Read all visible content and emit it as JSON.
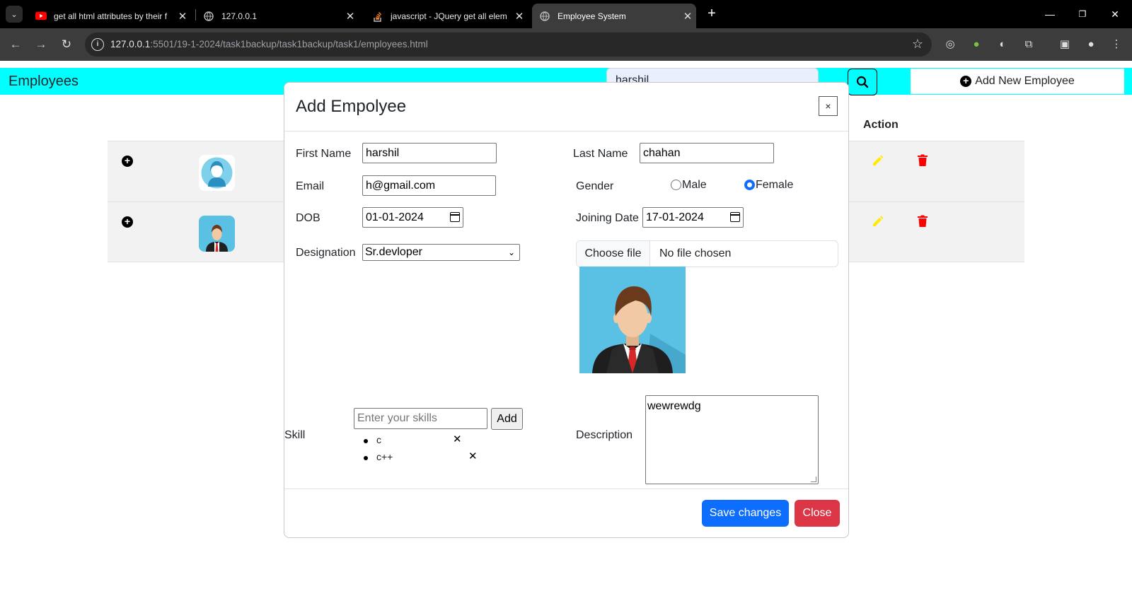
{
  "browser": {
    "tabs": [
      {
        "title": "get all html attributes by their f",
        "icon": "youtube-icon",
        "active": false
      },
      {
        "title": "127.0.0.1",
        "icon": "globe-icon",
        "active": false
      },
      {
        "title": "javascript - JQuery get all elem",
        "icon": "stackoverflow-icon",
        "active": false
      },
      {
        "title": "Employee System",
        "icon": "globe-icon",
        "active": true
      }
    ],
    "url_host": "127.0.0.1",
    "url_rest": ":5501/19-1-2024/task1backup/task1backup/task1/employees.html"
  },
  "navbar": {
    "brand": "Employees",
    "search_value": "harshil",
    "add_button_label": "Add New Employee",
    "accent_color": "#00ffff"
  },
  "table": {
    "action_header": "Action",
    "rows": [
      {
        "avatar": "female-avatar"
      },
      {
        "avatar": "male-avatar"
      }
    ]
  },
  "modal": {
    "title": "Add Empolyee",
    "close_symbol": "×",
    "first_name": {
      "label": "First Name",
      "value": "harshil"
    },
    "last_name": {
      "label": "Last Name",
      "value": "chahan"
    },
    "email": {
      "label": "Email",
      "value": "h@gmail.com"
    },
    "gender": {
      "label": "Gender",
      "options": [
        "Male",
        "Female"
      ],
      "selected": "Female"
    },
    "dob": {
      "label": "DOB",
      "value": "01-01-2024"
    },
    "joining_date": {
      "label": "Joining Date",
      "value": "17-01-2024"
    },
    "designation": {
      "label": "Designation",
      "value": "Sr.devloper"
    },
    "file": {
      "choose_label": "Choose file",
      "status": "No file chosen"
    },
    "skill": {
      "label": "Skill",
      "placeholder": "Enter your skills",
      "add_label": "Add",
      "items": [
        "c",
        "c++"
      ],
      "remove_symbol": "✕"
    },
    "description": {
      "label": "Description",
      "value": "wewrewdg"
    },
    "save_label": "Save changes",
    "close_label": "Close",
    "save_color": "#0d6efd",
    "close_color": "#dc3545"
  }
}
